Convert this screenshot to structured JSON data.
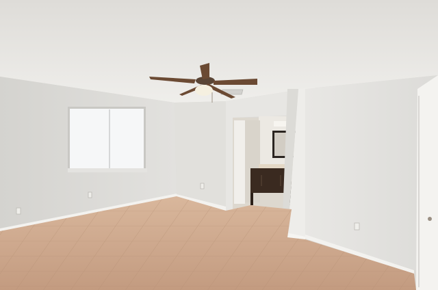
{
  "scene": {
    "description_colors": {
      "ceiling": "#e9e8e5",
      "wall_left": "#dddcd8",
      "wall_back": "#e3e2df",
      "wall_right": "#e6e5e2",
      "floor": "#caa58a",
      "grout": "#b78f74",
      "baseboard": "#f2f1ee",
      "fan_blade": "#6b4a33",
      "vanity": "#3a2a20",
      "window_glass": "#f6f7f8"
    }
  }
}
